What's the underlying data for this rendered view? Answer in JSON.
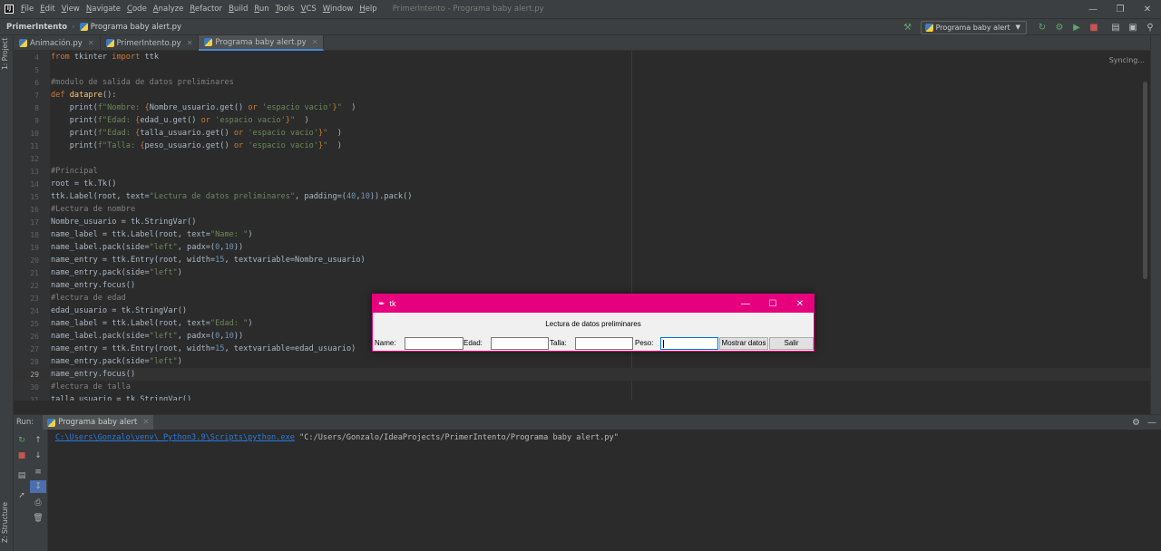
{
  "menubar": {
    "logo": "IJ",
    "items": [
      "File",
      "Edit",
      "View",
      "Navigate",
      "Code",
      "Analyze",
      "Refactor",
      "Build",
      "Run",
      "Tools",
      "VCS",
      "Window",
      "Help"
    ],
    "window_title": "PrimerIntento - Programa baby alert.py"
  },
  "navbar": {
    "project": "PrimerIntento",
    "file": "Programa baby alert.py",
    "run_config": "Programa baby alert"
  },
  "sidebar": {
    "project_label": "1: Project",
    "structure_label": "Z: Structure"
  },
  "tabs": [
    {
      "label": "Animación.py",
      "active": false
    },
    {
      "label": "PrimerIntento.py",
      "active": false
    },
    {
      "label": "Programa baby alert.py",
      "active": true
    }
  ],
  "editor": {
    "status": "Syncing...",
    "current_line": 29,
    "line_numbers": [
      "4",
      "5",
      "6",
      "7",
      "8",
      "9",
      "10",
      "11",
      "12",
      "13",
      "14",
      "15",
      "16",
      "17",
      "18",
      "19",
      "20",
      "21",
      "22",
      "23",
      "24",
      "25",
      "26",
      "27",
      "28",
      "29",
      "30",
      "31"
    ]
  },
  "tk_window": {
    "title": "tk",
    "heading": "Lectura de datos preliminares",
    "fields": [
      {
        "label": "Name:",
        "value": ""
      },
      {
        "label": "Edad:",
        "value": ""
      },
      {
        "label": "Talla:",
        "value": ""
      },
      {
        "label": "Peso:",
        "value": ""
      }
    ],
    "show_button": "Mostrar datos",
    "exit_button": "Salir",
    "accent": "#e6007e"
  },
  "run_panel": {
    "label": "Run:",
    "tab": "Programa baby alert",
    "console_interpreter": "C:\\Users\\Gonzalo\\venv\\ Python3.9\\Scripts\\python.exe",
    "console_script": " \"C:/Users/Gonzalo/IdeaProjects/PrimerIntento/Programa baby alert.py\""
  }
}
